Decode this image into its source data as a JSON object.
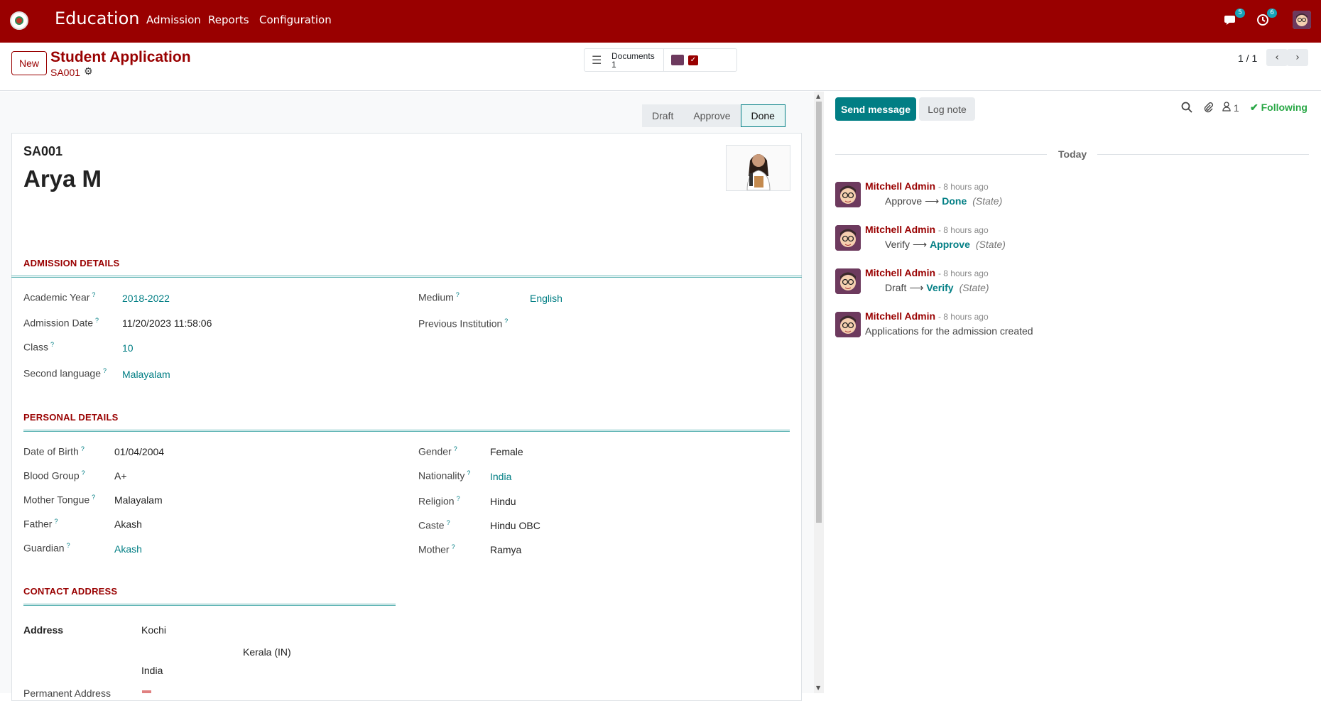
{
  "navbar": {
    "brand": "Education",
    "menus": [
      "Admission",
      "Reports",
      "Configuration"
    ],
    "messages_count": "5",
    "activities_count": "6"
  },
  "control": {
    "new_label": "New",
    "title": "Student Application",
    "record_ref": "SA001",
    "documents_label": "Documents",
    "documents_count": "1",
    "pager": "1 / 1"
  },
  "statusbar": [
    "Draft",
    "Approve",
    "Done"
  ],
  "record": {
    "ref": "SA001",
    "name": "Arya   M"
  },
  "admission": {
    "title": "ADMISSION DETAILS",
    "academic_year_label": "Academic Year",
    "academic_year": "2018-2022",
    "admission_date_label": "Admission Date",
    "admission_date": "11/20/2023 11:58:06",
    "class_label": "Class",
    "class": "10",
    "second_language_label": "Second language",
    "second_language": "Malayalam",
    "medium_label": "Medium",
    "medium": "English",
    "previous_institution_label": "Previous Institution"
  },
  "personal": {
    "title": "PERSONAL DETAILS",
    "dob_label": "Date of Birth",
    "dob": "01/04/2004",
    "blood_group_label": "Blood Group",
    "blood_group": "A+",
    "mother_tongue_label": "Mother Tongue",
    "mother_tongue": "Malayalam",
    "father_label": "Father",
    "father": "Akash",
    "guardian_label": "Guardian",
    "guardian": "Akash",
    "gender_label": "Gender",
    "gender": "Female",
    "nationality_label": "Nationality",
    "nationality": "India",
    "religion_label": "Religion",
    "religion": "Hindu",
    "caste_label": "Caste",
    "caste": "Hindu OBC",
    "mother_label": "Mother",
    "mother": "Ramya"
  },
  "contact": {
    "title": "CONTACT ADDRESS",
    "address_label": "Address",
    "city": "Kochi",
    "state": "Kerala (IN)",
    "country": "India",
    "permanent_label": "Permanent Address"
  },
  "chatter": {
    "send_label": "Send message",
    "log_label": "Log note",
    "followers": "1",
    "following_label": "Following",
    "today_label": "Today",
    "messages": [
      {
        "author": "Mitchell Admin",
        "time": "- 8 hours ago",
        "old": "Approve",
        "new": "Done",
        "field": "(State)"
      },
      {
        "author": "Mitchell Admin",
        "time": "- 8 hours ago",
        "old": "Verify",
        "new": "Approve",
        "field": "(State)"
      },
      {
        "author": "Mitchell Admin",
        "time": "- 8 hours ago",
        "old": "Draft",
        "new": "Verify",
        "field": "(State)"
      },
      {
        "author": "Mitchell Admin",
        "time": "- 8 hours ago",
        "body": "Applications for the admission created"
      }
    ]
  }
}
